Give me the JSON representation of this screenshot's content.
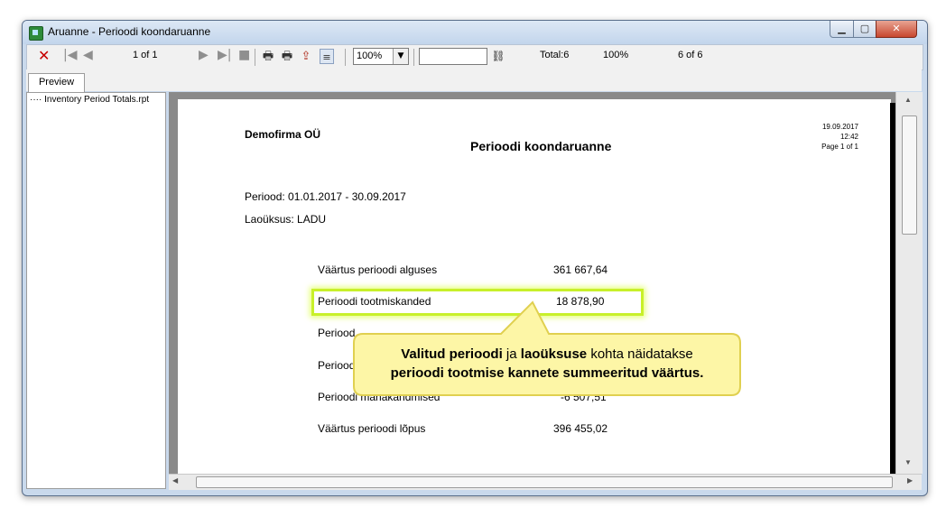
{
  "window": {
    "title": "Aruanne - Perioodi koondaruanne",
    "controls": {
      "minimize": "▁",
      "maximize": "▢",
      "close": "✕"
    }
  },
  "toolbar": {
    "page_indicator": "1 of 1",
    "zoom_value": "100%",
    "search_value": "",
    "total": "Total:6",
    "percent": "100%",
    "records": "6 of 6",
    "icons": [
      "close-icon",
      "first-page-icon",
      "prev-page-icon",
      "next-page-icon",
      "last-page-icon",
      "stop-icon",
      "print-icon",
      "print-setup-icon",
      "export-icon",
      "group-tree-icon",
      "find-icon"
    ]
  },
  "tabs": [
    {
      "label": "Preview"
    }
  ],
  "tree": {
    "items": [
      "Inventory Period Totals.rpt"
    ]
  },
  "report": {
    "company": "Demofirma OÜ",
    "title": "Perioodi koondaruanne",
    "date": "19.09.2017",
    "time": "12:42",
    "page": "Page 1 of 1",
    "period": "Periood: 01.01.2017 - 30.09.2017",
    "warehouse": "Laoüksus: LADU",
    "rows": [
      {
        "label": "Väärtus perioodi alguses",
        "value": "361 667,64"
      },
      {
        "label": "Perioodi tootmiskanded",
        "value": "18 878,90"
      },
      {
        "label": "Periood",
        "value": ""
      },
      {
        "label": "Periood",
        "value": ""
      },
      {
        "label": "Perioodi mahakandmised",
        "value": "-6 507,51"
      },
      {
        "label": "Väärtus perioodi lõpus",
        "value": "396 455,02"
      }
    ]
  },
  "callout": {
    "line1_bold_a": "Valitud perioodi",
    "line1_mid": " ja ",
    "line1_bold_b": "laoüksuse",
    "line1_end": " kohta näidatakse",
    "line2": "perioodi tootmise kannete summeeritud väärtus."
  },
  "colors": {
    "highlight": "#c8f02a",
    "callout_fill": "#fdf6a6",
    "callout_border": "#e0d050"
  }
}
